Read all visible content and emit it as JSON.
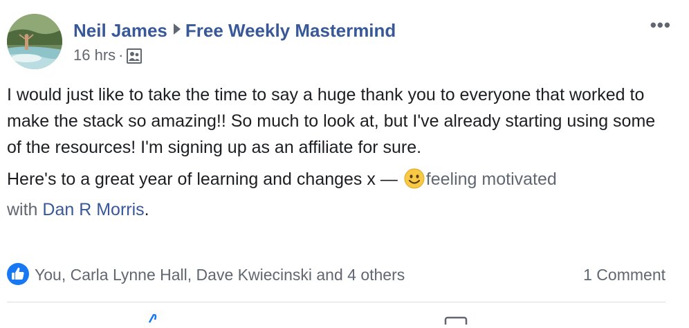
{
  "post": {
    "author": "Neil James",
    "group": "Free Weekly Mastermind",
    "time": "16 hrs",
    "separator": "·",
    "audience_icon": "group-audience-icon",
    "more_label": "•••",
    "paragraph1": "I would just like to take the time to say a huge thank you to everyone that worked to make the stack so amazing!! So much to look at, but I've already starting using some of the resources! I'm signing up as an affiliate for sure.",
    "paragraph2_text": "Here's to a great year of learning and changes x —",
    "feeling": "feeling motivated",
    "with_label": "with",
    "tagged": "Dan R Morris",
    "tagged_suffix": "."
  },
  "footer": {
    "reactors": "You, Carla Lynne Hall, Dave Kwiecinski and 4 others",
    "comments": "1 Comment"
  },
  "colors": {
    "link": "#385898",
    "secondary": "#606770",
    "like_blue": "#1877f2"
  }
}
